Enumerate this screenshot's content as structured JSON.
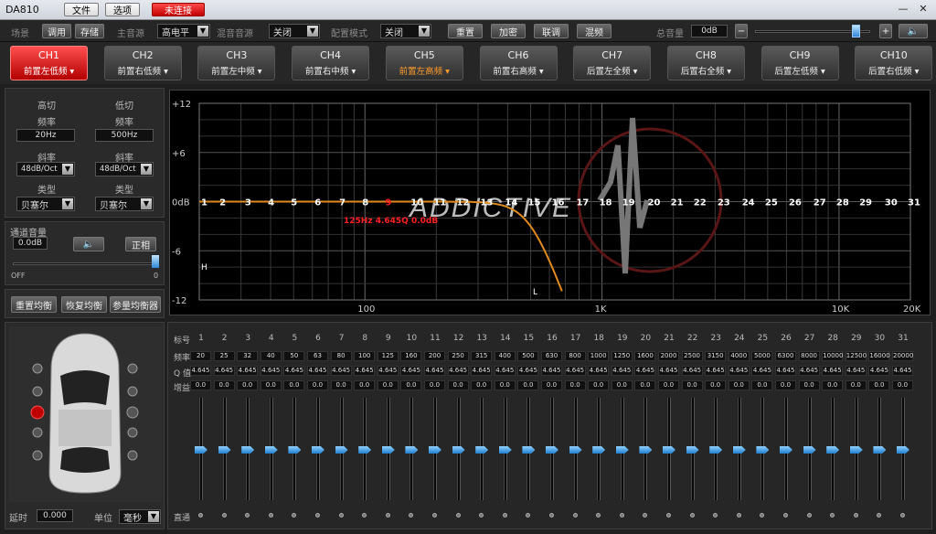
{
  "app": {
    "title": "DA810",
    "menu_file": "文件",
    "menu_options": "选项",
    "status": "未连接",
    "min": "—",
    "close": "✕"
  },
  "toolbar": {
    "scene": "场景",
    "recall": "调用",
    "store": "存储",
    "main_source": "主音源",
    "main_source_val": "高电平",
    "mix_source": "混音音源",
    "mix_source_val": "关闭",
    "config_mode": "配置模式",
    "config_mode_val": "关闭",
    "reset": "重置",
    "encrypt": "加密",
    "link": "联调",
    "mix": "混频",
    "total_volume": "总音量",
    "total_volume_val": "0dB",
    "vol_minus": "−",
    "vol_plus": "+"
  },
  "channels": [
    {
      "n": "CH1",
      "s": "前置左低频"
    },
    {
      "n": "CH2",
      "s": "前置右低频"
    },
    {
      "n": "CH3",
      "s": "前置左中频"
    },
    {
      "n": "CH4",
      "s": "前置右中频"
    },
    {
      "n": "CH5",
      "s": "前置左高频"
    },
    {
      "n": "CH6",
      "s": "前置右高频"
    },
    {
      "n": "CH7",
      "s": "后置左全频"
    },
    {
      "n": "CH8",
      "s": "后置右全频"
    },
    {
      "n": "CH9",
      "s": "后置左低频"
    },
    {
      "n": "CH10",
      "s": "后置右低频"
    }
  ],
  "xover": {
    "hp_title": "高切",
    "lp_title": "低切",
    "freq": "频率",
    "hp_freq": "20Hz",
    "lp_freq": "500Hz",
    "slope": "斜率",
    "hp_slope": "48dB/Oct",
    "lp_slope": "48dB/Oct",
    "type": "类型",
    "hp_type": "贝塞尔",
    "lp_type": "贝塞尔"
  },
  "chvol": {
    "title": "通道音量",
    "value": "0.0dB",
    "phase": "正相",
    "off": "OFF",
    "zero": "0"
  },
  "eqbtns": {
    "reset": "重置均衡",
    "restore": "恢复均衡",
    "param": "参量均衡器"
  },
  "graph": {
    "ylabels": [
      "+12",
      "+6",
      "0dB",
      "-6",
      "-12"
    ],
    "xlabels": [
      "100",
      "1K",
      "10K",
      "20K"
    ],
    "brand": "ADDICTIVE",
    "readout": "125Hz 4.645Q 0.0dB",
    "h": "H",
    "l": "L"
  },
  "eq": {
    "row_num": "标号",
    "row_freq": "频率",
    "row_q": "Q 值",
    "row_gain": "增益",
    "row_bypass": "直通",
    "freqs": [
      "20",
      "25",
      "32",
      "40",
      "50",
      "63",
      "80",
      "100",
      "125",
      "160",
      "200",
      "250",
      "315",
      "400",
      "500",
      "630",
      "800",
      "1000",
      "1250",
      "1600",
      "2000",
      "2500",
      "3150",
      "4000",
      "5000",
      "6300",
      "8000",
      "10000",
      "12500",
      "16000",
      "20000"
    ],
    "q": "4.645",
    "gain": "0.0"
  },
  "bottom": {
    "delay": "延时",
    "delay_val": "0.000",
    "unit": "单位",
    "unit_val": "毫秒"
  }
}
